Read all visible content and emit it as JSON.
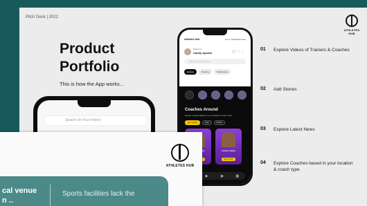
{
  "main_slide": {
    "pitch_label": "Pitch Deck | 2022",
    "logo_text": "ATHLETES HUB",
    "title_line1": "Product",
    "title_line2": "Portfolio",
    "subtitle": "This is how the App works...",
    "phone1": {
      "search_placeholder": "Search On Your Friend"
    },
    "phone2": {
      "brand": "Athletes Hub",
      "location": "Go to: Karachi/Current",
      "welcome": "Welcome",
      "user_name": "Candy Aysash",
      "search_placeholder": "Search On Your Friend",
      "tabs": [
        "Explore",
        "Booking",
        "Marketplace"
      ],
      "active_tab": "Explore",
      "section_title": "Coaches Around",
      "section_subtitle": "Explore Coaches Based in your location & Coach Type",
      "filters": [
        "Gym Coach",
        "Yoga",
        "Fitness"
      ],
      "cards": [
        {
          "name": "Lauren Chok",
          "button": "Gym Coach"
        },
        {
          "name": "Libsaro Sloan",
          "button": "Gym Coach"
        }
      ]
    },
    "features": [
      {
        "num": "01",
        "text": "Explore Videos of Trainers & Coaches"
      },
      {
        "num": "02",
        "text": "Add Stories"
      },
      {
        "num": "03",
        "text": "Explore Latest News"
      },
      {
        "num": "04",
        "text": "Explore Coaches based in your location & coach type"
      }
    ]
  },
  "overlay_slide": {
    "logo_text": "ATHLETES HUB",
    "left_text_line1": "cal venue",
    "left_text_line2": "n     ..",
    "right_text": "Sports facilities lack the"
  }
}
